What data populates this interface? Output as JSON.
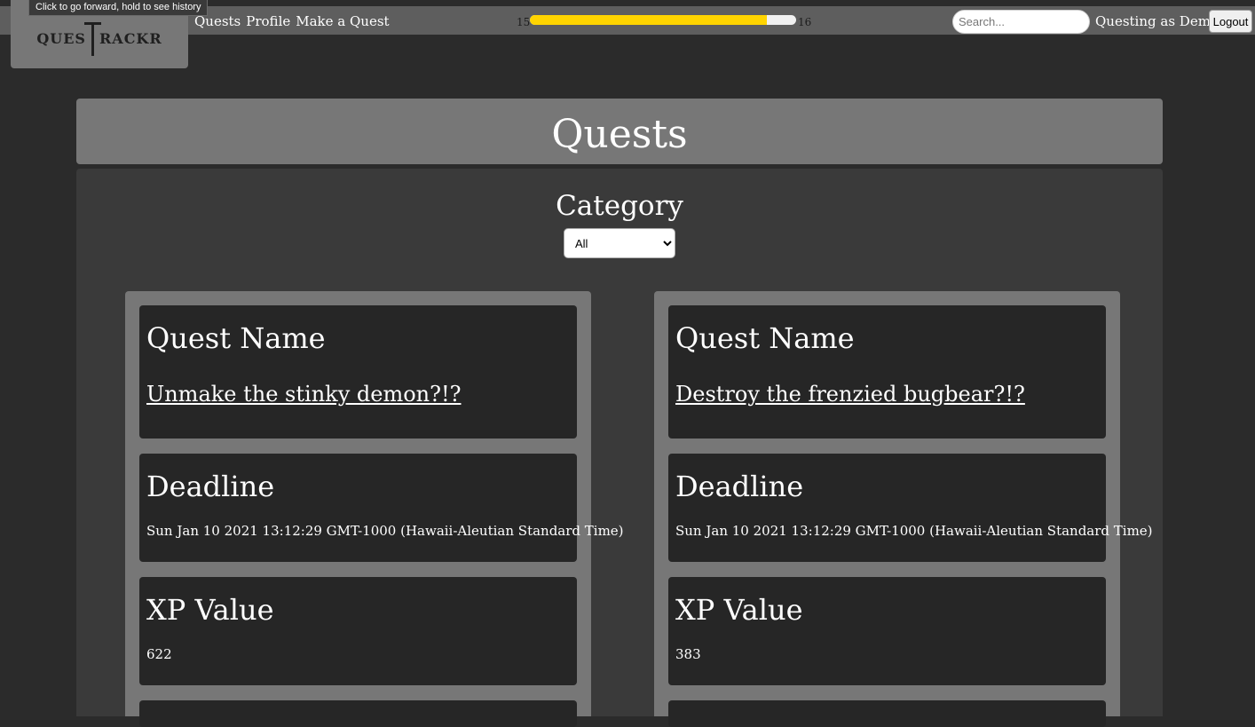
{
  "browser": {
    "tooltip": "Click to go forward, hold to see history"
  },
  "nav": {
    "logo_text_left": "QUES",
    "logo_text_right": "RACKR",
    "links": [
      "Quests",
      "Profile",
      "Make a Quest"
    ],
    "level_current": "15",
    "level_next": "16",
    "xp_progress_percent": 89,
    "xp_bar_color": "#ffd400",
    "search_placeholder": "Search...",
    "questing_as": "Questing as Demo",
    "logout_label": "Logout"
  },
  "page": {
    "title": "Quests",
    "category_label": "Category",
    "category_selected": "All"
  },
  "quests": [
    {
      "name_label": "Quest Name",
      "name": "Unmake the stinky demon?!?",
      "deadline_label": "Deadline",
      "deadline": "Sun Jan 10 2021 13:12:29 GMT-1000 (Hawaii-Aleutian Standard Time)",
      "xp_label": "XP Value",
      "xp": "622"
    },
    {
      "name_label": "Quest Name",
      "name": "Destroy the frenzied bugbear?!?",
      "deadline_label": "Deadline",
      "deadline": "Sun Jan 10 2021 13:12:29 GMT-1000 (Hawaii-Aleutian Standard Time)",
      "xp_label": "XP Value",
      "xp": "383"
    }
  ]
}
